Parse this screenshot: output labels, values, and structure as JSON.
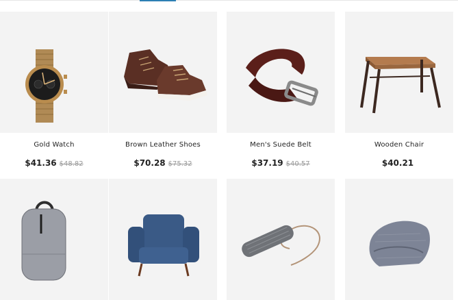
{
  "products": [
    {
      "name": "Gold Watch",
      "price": "$41.36",
      "old_price": "$48.82"
    },
    {
      "name": "Brown Leather Shoes",
      "price": "$70.28",
      "old_price": "$75.32"
    },
    {
      "name": "Men's Suede Belt",
      "price": "$37.19",
      "old_price": "$40.57"
    },
    {
      "name": "Wooden Chair",
      "price": "$40.21",
      "old_price": ""
    },
    {
      "name": "",
      "price": "",
      "old_price": ""
    },
    {
      "name": "",
      "price": "",
      "old_price": ""
    },
    {
      "name": "",
      "price": "",
      "old_price": ""
    },
    {
      "name": "",
      "price": "",
      "old_price": ""
    }
  ]
}
